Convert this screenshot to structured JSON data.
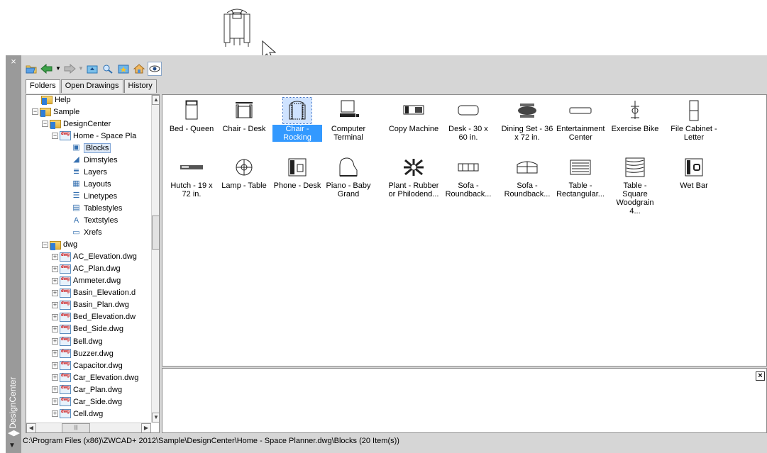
{
  "palette": {
    "title": "DesignCenter",
    "close_glyph": "×"
  },
  "toolbar": {
    "buttons": [
      {
        "name": "load-icon"
      },
      {
        "name": "back-icon"
      },
      {
        "name": "forward-icon"
      },
      {
        "name": "up-icon"
      },
      {
        "name": "search-icon"
      },
      {
        "name": "favorites-icon"
      },
      {
        "name": "home-icon"
      },
      {
        "name": "tree-view-toggle-icon"
      }
    ]
  },
  "tabs": [
    {
      "label": "Folders",
      "active": true
    },
    {
      "label": "Open Drawings",
      "active": false
    },
    {
      "label": "History",
      "active": false
    }
  ],
  "tree": {
    "rows": [
      {
        "label": "Help",
        "icon": "folder-icon",
        "indent": 0,
        "expander": ""
      },
      {
        "label": "Sample",
        "icon": "folder-icon",
        "indent": 0,
        "expander": "−"
      },
      {
        "label": "DesignCenter",
        "icon": "folder-icon",
        "indent": 1,
        "expander": "−"
      },
      {
        "label": "Home - Space Pla",
        "icon": "dwg-icon",
        "indent": 2,
        "expander": "−"
      },
      {
        "label": "Blocks",
        "icon": "blocks-icon",
        "indent": 3,
        "expander": "",
        "selected": true
      },
      {
        "label": "Dimstyles",
        "icon": "dimstyles-icon",
        "indent": 3,
        "expander": ""
      },
      {
        "label": "Layers",
        "icon": "layers-icon",
        "indent": 3,
        "expander": ""
      },
      {
        "label": "Layouts",
        "icon": "layouts-icon",
        "indent": 3,
        "expander": ""
      },
      {
        "label": "Linetypes",
        "icon": "linetypes-icon",
        "indent": 3,
        "expander": ""
      },
      {
        "label": "Tablestyles",
        "icon": "tablestyles-icon",
        "indent": 3,
        "expander": ""
      },
      {
        "label": "Textstyles",
        "icon": "textstyles-icon",
        "indent": 3,
        "expander": ""
      },
      {
        "label": "Xrefs",
        "icon": "xrefs-icon",
        "indent": 3,
        "expander": ""
      },
      {
        "label": "dwg",
        "icon": "folder-icon",
        "indent": 1,
        "expander": "−"
      },
      {
        "label": "AC_Elevation.dwg",
        "icon": "dwg-icon",
        "indent": 2,
        "expander": "+"
      },
      {
        "label": "AC_Plan.dwg",
        "icon": "dwg-icon",
        "indent": 2,
        "expander": "+"
      },
      {
        "label": "Ammeter.dwg",
        "icon": "dwg-icon",
        "indent": 2,
        "expander": "+"
      },
      {
        "label": "Basin_Elevation.d",
        "icon": "dwg-icon",
        "indent": 2,
        "expander": "+"
      },
      {
        "label": "Basin_Plan.dwg",
        "icon": "dwg-icon",
        "indent": 2,
        "expander": "+"
      },
      {
        "label": "Bed_Elevation.dw",
        "icon": "dwg-icon",
        "indent": 2,
        "expander": "+"
      },
      {
        "label": "Bed_Side.dwg",
        "icon": "dwg-icon",
        "indent": 2,
        "expander": "+"
      },
      {
        "label": "Bell.dwg",
        "icon": "dwg-icon",
        "indent": 2,
        "expander": "+"
      },
      {
        "label": "Buzzer.dwg",
        "icon": "dwg-icon",
        "indent": 2,
        "expander": "+"
      },
      {
        "label": "Capacitor.dwg",
        "icon": "dwg-icon",
        "indent": 2,
        "expander": "+"
      },
      {
        "label": "Car_Elevation.dwg",
        "icon": "dwg-icon",
        "indent": 2,
        "expander": "+"
      },
      {
        "label": "Car_Plan.dwg",
        "icon": "dwg-icon",
        "indent": 2,
        "expander": "+"
      },
      {
        "label": "Car_Side.dwg",
        "icon": "dwg-icon",
        "indent": 2,
        "expander": "+"
      },
      {
        "label": "Cell.dwg",
        "icon": "dwg-icon",
        "indent": 2,
        "expander": "+"
      }
    ]
  },
  "blocks": [
    {
      "label": "Bed - Queen",
      "icon": "bed-queen-icon"
    },
    {
      "label": "Chair - Desk",
      "icon": "chair-desk-icon"
    },
    {
      "label": "Chair - Rocking",
      "icon": "chair-rocking-icon",
      "selected": true
    },
    {
      "label": "Computer Terminal",
      "icon": "computer-terminal-icon"
    },
    {
      "label": "Copy Machine",
      "icon": "copy-machine-icon"
    },
    {
      "label": "Desk - 30 x 60 in.",
      "icon": "desk-icon"
    },
    {
      "label": "Dining Set - 36 x 72 in.",
      "icon": "dining-set-icon"
    },
    {
      "label": "Entertainment Center",
      "icon": "entertainment-center-icon"
    },
    {
      "label": "Exercise Bike",
      "icon": "exercise-bike-icon"
    },
    {
      "label": "File Cabinet - Letter",
      "icon": "file-cabinet-icon"
    },
    {
      "label": "Hutch - 19 x 72 in.",
      "icon": "hutch-icon"
    },
    {
      "label": "Lamp - Table",
      "icon": "lamp-table-icon"
    },
    {
      "label": "Phone - Desk",
      "icon": "phone-desk-icon"
    },
    {
      "label": "Piano - Baby Grand",
      "icon": "piano-icon"
    },
    {
      "label": "Plant - Rubber or Philodend...",
      "icon": "plant-icon"
    },
    {
      "label": "Sofa - Roundback...",
      "icon": "sofa-icon"
    },
    {
      "label": "Sofa - Roundback...",
      "icon": "sofa-2-icon"
    },
    {
      "label": "Table - Rectangular...",
      "icon": "table-rectangular-icon"
    },
    {
      "label": "Table - Square Woodgrain 4...",
      "icon": "table-square-icon"
    },
    {
      "label": "Wet Bar",
      "icon": "wet-bar-icon"
    }
  ],
  "status_bar": {
    "path": "C:\\Program Files (x86)\\ZWCAD+ 2012\\Sample\\DesignCenter\\Home - Space Planner.dwg\\Blocks (20 Item(s))"
  },
  "preview": {
    "close_glyph": "×"
  }
}
